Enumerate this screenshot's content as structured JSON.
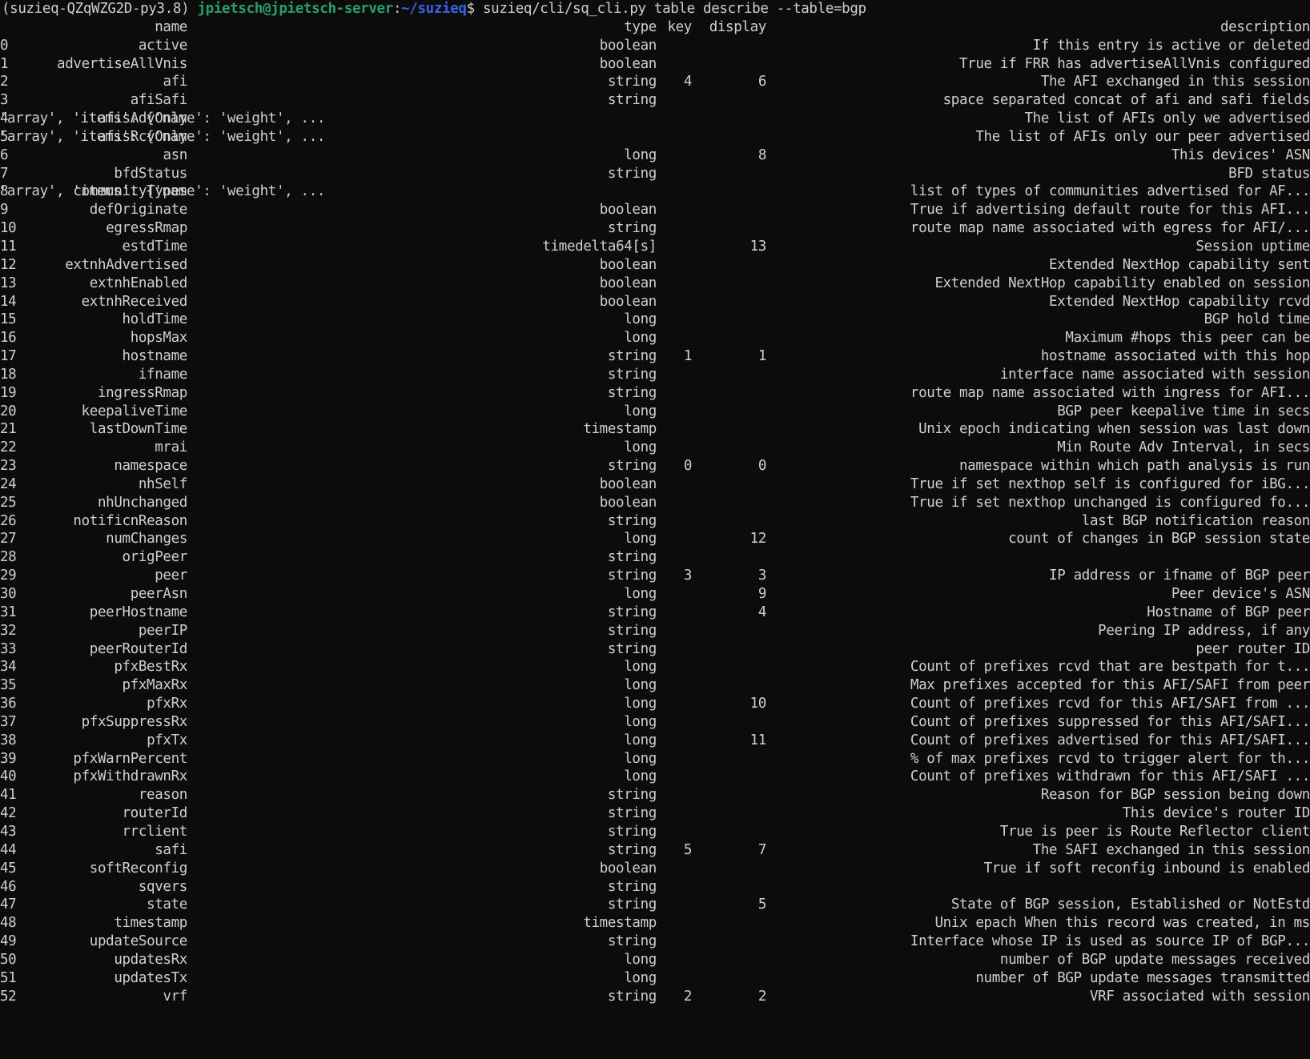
{
  "terminal": {
    "background": "#0c0c0c",
    "foreground": "#d0cfcc",
    "prompt": {
      "venv": "(suzieq-QZqWZG2D-py3.8) ",
      "userhost": "jpietsch@jpietsch-server",
      "colon": ":",
      "path": "~/suzieq",
      "dollar": "$",
      "command": " suzieq/cli/sq_cli.py table describe --table=bgp",
      "userhost_color": "#26a269",
      "path_color": "#3465e4"
    }
  },
  "table": {
    "headers": {
      "index": "",
      "name": "name",
      "type": "type",
      "key": "key",
      "display": "display",
      "description": "description"
    },
    "rows": [
      {
        "idx": "0",
        "name": "active",
        "type": "boolean",
        "key": "",
        "display": "",
        "desc": "If this entry is active or deleted",
        "overflow": false
      },
      {
        "idx": "1",
        "name": "advertiseAllVnis",
        "type": "boolean",
        "key": "",
        "display": "",
        "desc": "True if FRR has advertiseAllVnis configured",
        "overflow": false
      },
      {
        "idx": "2",
        "name": "afi",
        "type": "string",
        "key": "4",
        "display": "6",
        "desc": "The AFI exchanged in this session",
        "overflow": false
      },
      {
        "idx": "3",
        "name": "afiSafi",
        "type": "string",
        "key": "",
        "display": "",
        "desc": "space separated concat of afi and safi fields",
        "overflow": false
      },
      {
        "idx": "4",
        "name": "afisAdvOnly",
        "type": "{'type': 'array', 'items': {'name': 'weight', ...",
        "key": "",
        "display": "",
        "desc": "The list of AFIs only we advertised",
        "overflow": true
      },
      {
        "idx": "5",
        "name": "afisRcvOnly",
        "type": "{'type': 'array', 'items': {'name': 'weight', ...",
        "key": "",
        "display": "",
        "desc": "The list of AFIs only our peer advertised",
        "overflow": true
      },
      {
        "idx": "6",
        "name": "asn",
        "type": "long",
        "key": "",
        "display": "8",
        "desc": "This devices' ASN",
        "overflow": false
      },
      {
        "idx": "7",
        "name": "bfdStatus",
        "type": "string",
        "key": "",
        "display": "",
        "desc": "BFD status",
        "overflow": false
      },
      {
        "idx": "8",
        "name": "communityTypes",
        "type": "{'type': 'array', 'items': {'name': 'weight', ...",
        "key": "",
        "display": "",
        "desc": "list of types of communities advertised for AF...",
        "overflow": true
      },
      {
        "idx": "9",
        "name": "defOriginate",
        "type": "boolean",
        "key": "",
        "display": "",
        "desc": "True if advertising default route for this AFI...",
        "overflow": false
      },
      {
        "idx": "10",
        "name": "egressRmap",
        "type": "string",
        "key": "",
        "display": "",
        "desc": "route map name associated with egress for AFI/...",
        "overflow": false
      },
      {
        "idx": "11",
        "name": "estdTime",
        "type": "timedelta64[s]",
        "key": "",
        "display": "13",
        "desc": "Session uptime",
        "overflow": false
      },
      {
        "idx": "12",
        "name": "extnhAdvertised",
        "type": "boolean",
        "key": "",
        "display": "",
        "desc": "Extended NextHop capability sent",
        "overflow": false
      },
      {
        "idx": "13",
        "name": "extnhEnabled",
        "type": "boolean",
        "key": "",
        "display": "",
        "desc": "Extended NextHop capability enabled on session",
        "overflow": false
      },
      {
        "idx": "14",
        "name": "extnhReceived",
        "type": "boolean",
        "key": "",
        "display": "",
        "desc": "Extended NextHop capability rcvd",
        "overflow": false
      },
      {
        "idx": "15",
        "name": "holdTime",
        "type": "long",
        "key": "",
        "display": "",
        "desc": "BGP hold time",
        "overflow": false
      },
      {
        "idx": "16",
        "name": "hopsMax",
        "type": "long",
        "key": "",
        "display": "",
        "desc": "Maximum #hops this peer can be",
        "overflow": false
      },
      {
        "idx": "17",
        "name": "hostname",
        "type": "string",
        "key": "1",
        "display": "1",
        "desc": "hostname associated with this hop",
        "overflow": false
      },
      {
        "idx": "18",
        "name": "ifname",
        "type": "string",
        "key": "",
        "display": "",
        "desc": "interface name associated with session",
        "overflow": false
      },
      {
        "idx": "19",
        "name": "ingressRmap",
        "type": "string",
        "key": "",
        "display": "",
        "desc": "route map name associated with ingress for AFI...",
        "overflow": false
      },
      {
        "idx": "20",
        "name": "keepaliveTime",
        "type": "long",
        "key": "",
        "display": "",
        "desc": "BGP peer keepalive time in secs",
        "overflow": false
      },
      {
        "idx": "21",
        "name": "lastDownTime",
        "type": "timestamp",
        "key": "",
        "display": "",
        "desc": "Unix epoch indicating when session was last down",
        "overflow": false
      },
      {
        "idx": "22",
        "name": "mrai",
        "type": "long",
        "key": "",
        "display": "",
        "desc": "Min Route Adv Interval, in secs",
        "overflow": false
      },
      {
        "idx": "23",
        "name": "namespace",
        "type": "string",
        "key": "0",
        "display": "0",
        "desc": "namespace within which path analysis is run",
        "overflow": false
      },
      {
        "idx": "24",
        "name": "nhSelf",
        "type": "boolean",
        "key": "",
        "display": "",
        "desc": "True if set nexthop self is configured for iBG...",
        "overflow": false
      },
      {
        "idx": "25",
        "name": "nhUnchanged",
        "type": "boolean",
        "key": "",
        "display": "",
        "desc": "True if set nexthop unchanged is configured fo...",
        "overflow": false
      },
      {
        "idx": "26",
        "name": "notificnReason",
        "type": "string",
        "key": "",
        "display": "",
        "desc": "last BGP notification reason",
        "overflow": false
      },
      {
        "idx": "27",
        "name": "numChanges",
        "type": "long",
        "key": "",
        "display": "12",
        "desc": "count of changes in BGP session state",
        "overflow": false
      },
      {
        "idx": "28",
        "name": "origPeer",
        "type": "string",
        "key": "",
        "display": "",
        "desc": "",
        "overflow": false
      },
      {
        "idx": "29",
        "name": "peer",
        "type": "string",
        "key": "3",
        "display": "3",
        "desc": "IP address or ifname of BGP peer",
        "overflow": false
      },
      {
        "idx": "30",
        "name": "peerAsn",
        "type": "long",
        "key": "",
        "display": "9",
        "desc": "Peer device's ASN",
        "overflow": false
      },
      {
        "idx": "31",
        "name": "peerHostname",
        "type": "string",
        "key": "",
        "display": "4",
        "desc": "Hostname of BGP peer",
        "overflow": false
      },
      {
        "idx": "32",
        "name": "peerIP",
        "type": "string",
        "key": "",
        "display": "",
        "desc": "Peering IP address, if any",
        "overflow": false
      },
      {
        "idx": "33",
        "name": "peerRouterId",
        "type": "string",
        "key": "",
        "display": "",
        "desc": "peer router ID",
        "overflow": false
      },
      {
        "idx": "34",
        "name": "pfxBestRx",
        "type": "long",
        "key": "",
        "display": "",
        "desc": "Count of prefixes rcvd that are bestpath for t...",
        "overflow": false
      },
      {
        "idx": "35",
        "name": "pfxMaxRx",
        "type": "long",
        "key": "",
        "display": "",
        "desc": "Max prefixes accepted for this AFI/SAFI from peer",
        "overflow": false
      },
      {
        "idx": "36",
        "name": "pfxRx",
        "type": "long",
        "key": "",
        "display": "10",
        "desc": "Count of prefixes rcvd for this AFI/SAFI from ...",
        "overflow": false
      },
      {
        "idx": "37",
        "name": "pfxSuppressRx",
        "type": "long",
        "key": "",
        "display": "",
        "desc": "Count of prefixes suppressed for this AFI/SAFI...",
        "overflow": false
      },
      {
        "idx": "38",
        "name": "pfxTx",
        "type": "long",
        "key": "",
        "display": "11",
        "desc": "Count of prefixes advertised for this AFI/SAFI...",
        "overflow": false
      },
      {
        "idx": "39",
        "name": "pfxWarnPercent",
        "type": "long",
        "key": "",
        "display": "",
        "desc": "% of max prefixes rcvd to trigger alert for th...",
        "overflow": false
      },
      {
        "idx": "40",
        "name": "pfxWithdrawnRx",
        "type": "long",
        "key": "",
        "display": "",
        "desc": "Count of prefixes withdrawn for this AFI/SAFI ...",
        "overflow": false
      },
      {
        "idx": "41",
        "name": "reason",
        "type": "string",
        "key": "",
        "display": "",
        "desc": "Reason for BGP session being down",
        "overflow": false
      },
      {
        "idx": "42",
        "name": "routerId",
        "type": "string",
        "key": "",
        "display": "",
        "desc": "This device's router ID",
        "overflow": false
      },
      {
        "idx": "43",
        "name": "rrclient",
        "type": "string",
        "key": "",
        "display": "",
        "desc": "True is peer is Route Reflector client",
        "overflow": false
      },
      {
        "idx": "44",
        "name": "safi",
        "type": "string",
        "key": "5",
        "display": "7",
        "desc": "The SAFI exchanged in this session",
        "overflow": false
      },
      {
        "idx": "45",
        "name": "softReconfig",
        "type": "boolean",
        "key": "",
        "display": "",
        "desc": "True if soft reconfig inbound is enabled",
        "overflow": false
      },
      {
        "idx": "46",
        "name": "sqvers",
        "type": "string",
        "key": "",
        "display": "",
        "desc": "",
        "overflow": false
      },
      {
        "idx": "47",
        "name": "state",
        "type": "string",
        "key": "",
        "display": "5",
        "desc": "State of BGP session, Established or NotEstd",
        "overflow": false
      },
      {
        "idx": "48",
        "name": "timestamp",
        "type": "timestamp",
        "key": "",
        "display": "",
        "desc": "Unix epach When this record was created, in ms",
        "overflow": false
      },
      {
        "idx": "49",
        "name": "updateSource",
        "type": "string",
        "key": "",
        "display": "",
        "desc": "Interface whose IP is used as source IP of BGP...",
        "overflow": false
      },
      {
        "idx": "50",
        "name": "updatesRx",
        "type": "long",
        "key": "",
        "display": "",
        "desc": "number of BGP update messages received",
        "overflow": false
      },
      {
        "idx": "51",
        "name": "updatesTx",
        "type": "long",
        "key": "",
        "display": "",
        "desc": "number of BGP update messages transmitted",
        "overflow": false
      },
      {
        "idx": "52",
        "name": "vrf",
        "type": "string",
        "key": "2",
        "display": "2",
        "desc": "VRF associated with session",
        "overflow": false
      }
    ]
  }
}
